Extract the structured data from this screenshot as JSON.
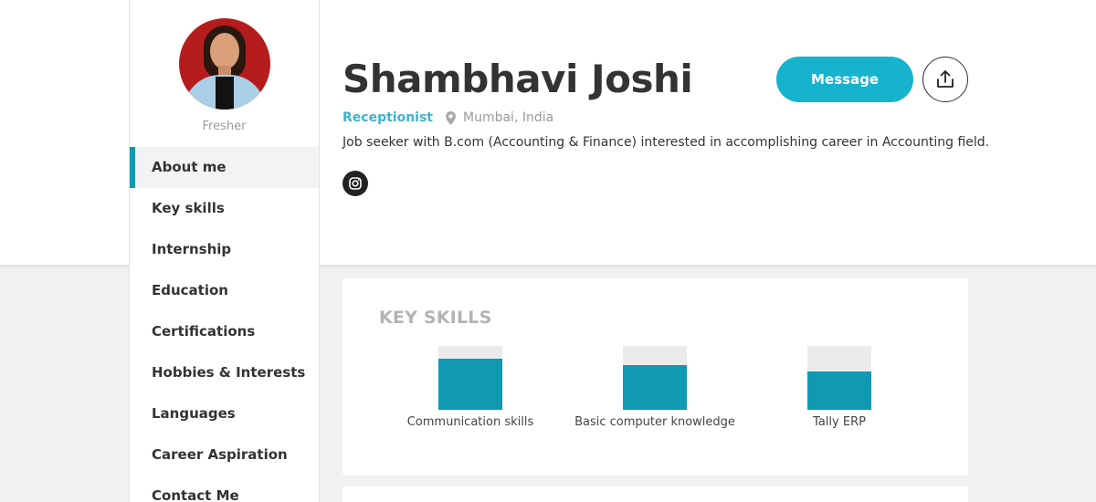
{
  "profile": {
    "name": "Shambhavi Joshi",
    "role": "Receptionist",
    "location": "Mumbai, India",
    "status": "Fresher",
    "bio": "Job seeker with B.com (Accounting & Finance) interested in accomplishing career in Accounting field."
  },
  "actions": {
    "message_label": "Message",
    "share_icon": "share-icon",
    "instagram_icon": "instagram-icon"
  },
  "sidebar": {
    "items": [
      {
        "label": "About me",
        "active": true
      },
      {
        "label": "Key skills"
      },
      {
        "label": "Internship"
      },
      {
        "label": "Education"
      },
      {
        "label": "Certifications"
      },
      {
        "label": "Hobbies & Interests"
      },
      {
        "label": "Languages"
      },
      {
        "label": "Career Aspiration"
      },
      {
        "label": "Contact Me"
      }
    ]
  },
  "key_skills": {
    "title": "KEY SKILLS",
    "skills": [
      {
        "label": "Communication skills",
        "level": 0.8
      },
      {
        "label": "Basic computer knowledge",
        "level": 0.7
      },
      {
        "label": "Tally ERP",
        "level": 0.6
      }
    ]
  },
  "colors": {
    "accent": "#16b3cd",
    "bar": "#1199b2",
    "role": "#3fb3c8"
  }
}
